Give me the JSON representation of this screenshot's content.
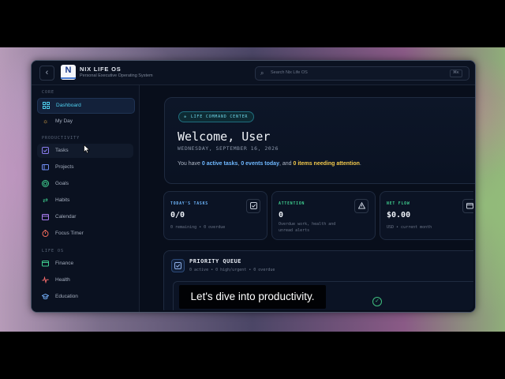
{
  "app": {
    "name": "NIX LIFE OS",
    "subtitle": "Personal Executive Operating System",
    "logo_letter": "N"
  },
  "search": {
    "placeholder": "Search Nix Life OS",
    "shortcut": "⌘K"
  },
  "sidebar": {
    "sections": [
      {
        "label": "CORE"
      },
      {
        "label": "PRODUCTIVITY"
      },
      {
        "label": "LIFE OS"
      }
    ],
    "items": [
      {
        "label": "Dashboard",
        "icon": "grid-icon",
        "color": "#4fd0f0"
      },
      {
        "label": "My Day",
        "icon": "sun-icon",
        "color": "#f2b84c"
      },
      {
        "label": "Tasks",
        "icon": "checkbox-icon",
        "color": "#8a7cf0"
      },
      {
        "label": "Projects",
        "icon": "folder-icon",
        "color": "#6f8cf0"
      },
      {
        "label": "Goals",
        "icon": "target-icon",
        "color": "#3fcf8f"
      },
      {
        "label": "Habits",
        "icon": "repeat-icon",
        "color": "#3fcf8f"
      },
      {
        "label": "Calendar",
        "icon": "calendar-icon",
        "color": "#a97cf0"
      },
      {
        "label": "Focus Timer",
        "icon": "timer-icon",
        "color": "#f06a5a"
      },
      {
        "label": "Finance",
        "icon": "wallet-icon",
        "color": "#3fcf8f"
      },
      {
        "label": "Health",
        "icon": "pulse-icon",
        "color": "#f06a6a"
      },
      {
        "label": "Education",
        "icon": "graduation-cap-icon",
        "color": "#6fa8f0"
      }
    ]
  },
  "hero": {
    "badge": "LIFE COMMAND CENTER",
    "welcome": "Welcome, User",
    "date": "WEDNESDAY, SEPTEMBER 16, 2026",
    "summary_prefix": "You have ",
    "active_tasks": "0 active tasks",
    "sep1": ", ",
    "events": "0 events today",
    "sep2": ", and ",
    "attention": "0 items needing attention",
    "suffix": "."
  },
  "cards": [
    {
      "title": "TODAY'S TASKS",
      "value": "0/0",
      "note": "0 remaining • 0 overdue",
      "title_color": "#6fb8ff",
      "icon": "checkbox-icon"
    },
    {
      "title": "ATTENTION",
      "value": "0",
      "note": "Overdue work, health and unread alerts",
      "title_color": "#3fcf8f",
      "icon": "warning-icon"
    },
    {
      "title": "NET FLOW",
      "value": "$0.00",
      "note": "USD • current month",
      "title_color": "#3fcf8f",
      "icon": "wallet-icon"
    }
  ],
  "queue": {
    "title": "PRIORITY QUEUE",
    "subtitle": "0 active • 0 high/urgent • 0 overdue"
  },
  "caption": "Let's dive into productivity."
}
